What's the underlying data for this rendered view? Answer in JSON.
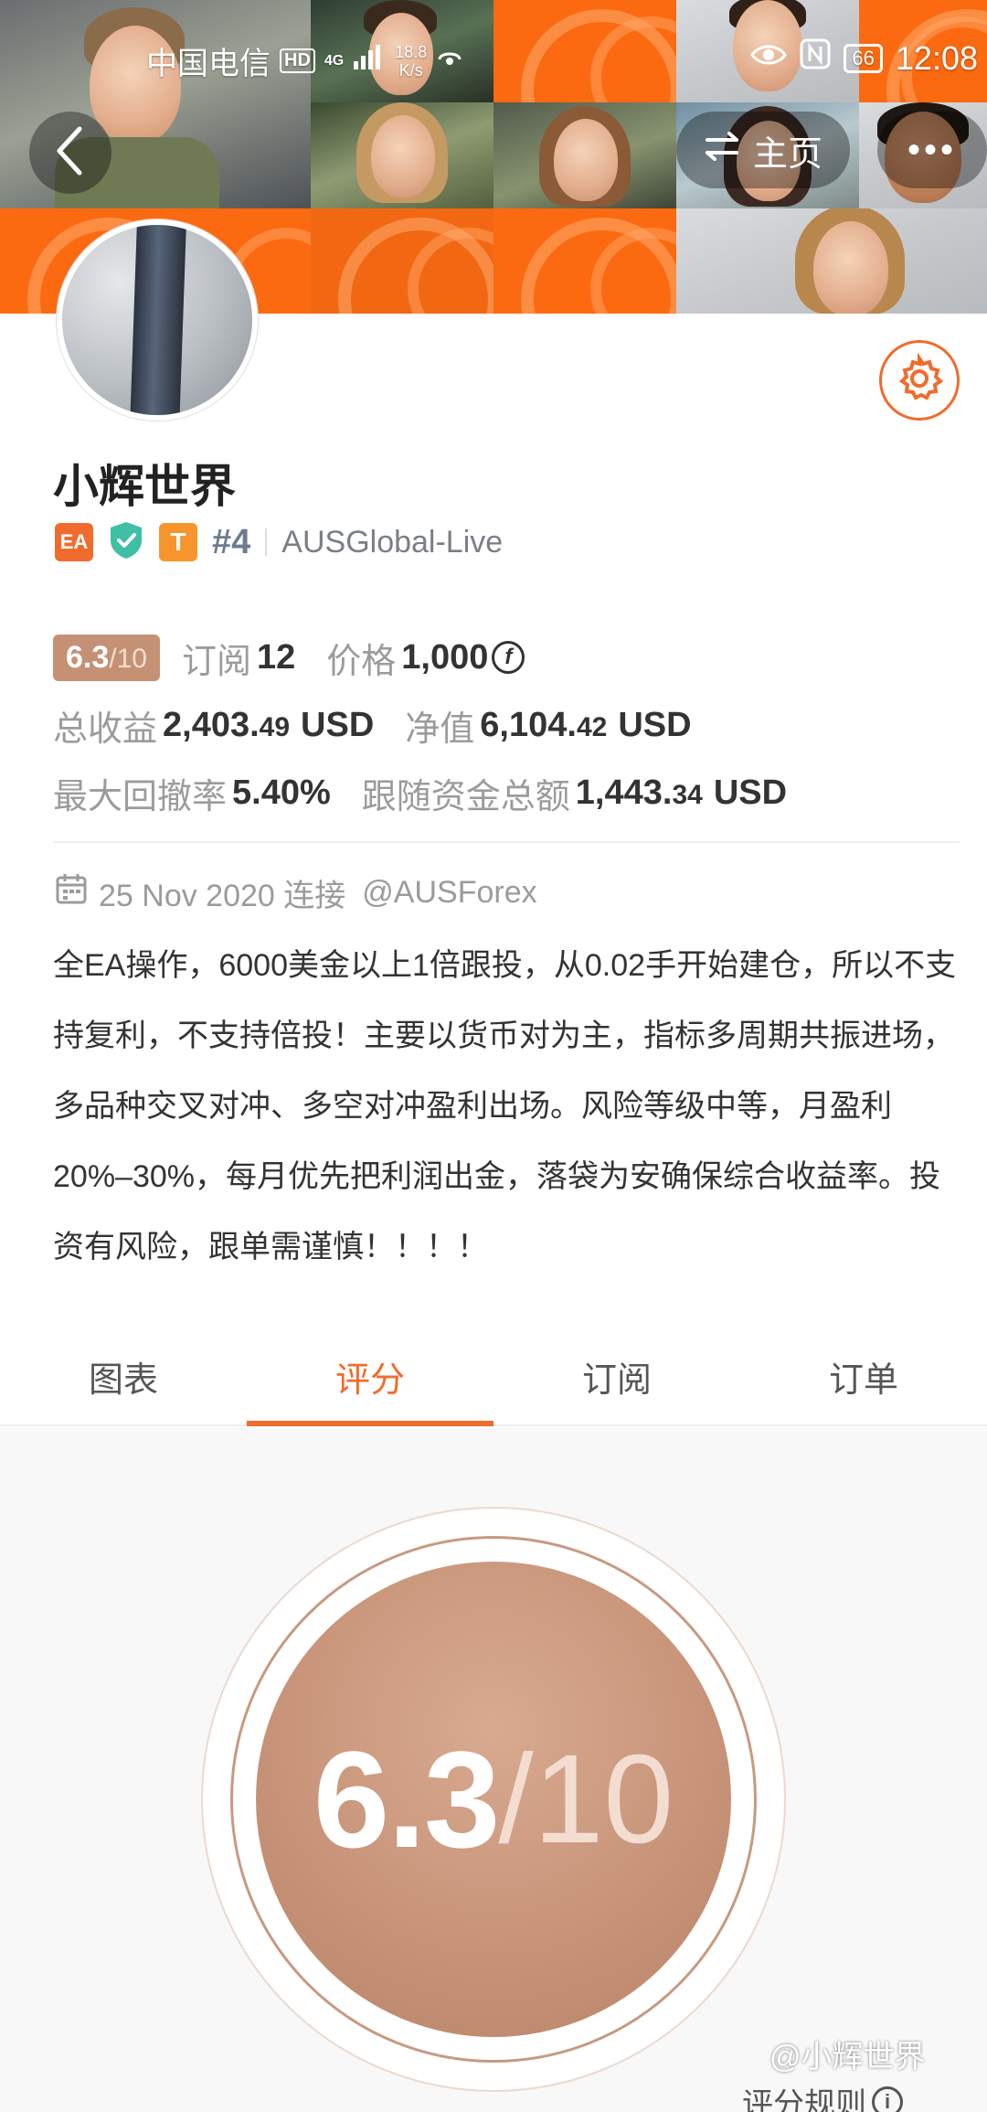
{
  "status_bar": {
    "carrier": "中国电信",
    "hd_badge": "HD",
    "network_type": "4G",
    "net_speed_value": "18.8",
    "net_speed_unit": "K/s",
    "battery": "66",
    "time": "12:08"
  },
  "header": {
    "home_label": "主页",
    "more_label": "•••"
  },
  "profile": {
    "name": "小辉世界",
    "badge_ea": "EA",
    "badge_t": "T",
    "rank": "#4",
    "server": "AUSGlobal-Live"
  },
  "stats": {
    "score_main": "6.3",
    "score_den": "/10",
    "subscribe_label": "订阅",
    "subscribe_value": "12",
    "price_label": "价格",
    "price_value": "1,000",
    "total_profit_label": "总收益",
    "total_profit_int": "2,403.",
    "total_profit_dec": "49",
    "total_profit_unit": "USD",
    "net_value_label": "净值",
    "net_value_int": "6,104.",
    "net_value_dec": "42",
    "net_value_unit": "USD",
    "drawdown_label": "最大回撤率",
    "drawdown_value": "5.40%",
    "follow_funds_label": "跟随资金总额",
    "follow_funds_int": "1,443.",
    "follow_funds_dec": "34",
    "follow_funds_unit": "USD"
  },
  "connection": {
    "date_text": "25 Nov 2020 连接",
    "handle": "@AUSForex"
  },
  "description": "全EA操作，6000美金以上1倍跟投，从0.02手开始建仓，所以不支持复利，不支持倍投！主要以货币对为主，指标多周期共振进场，多品种交叉对冲、多空对冲盈利出场。风险等级中等，月盈利20%–30%，每月优先把利润出金，落袋为安确保综合收益率。投资有风险，跟单需谨慎！！！！",
  "tabs": [
    {
      "label": "图表",
      "active": false
    },
    {
      "label": "评分",
      "active": true
    },
    {
      "label": "订阅",
      "active": false
    },
    {
      "label": "订单",
      "active": false
    }
  ],
  "score_panel": {
    "score": "6.3",
    "den": "/10",
    "rules_label": "评分规则"
  },
  "watermark": "@小辉世界",
  "colors": {
    "accent": "#f06b2c",
    "score_chip": "#c59175",
    "banner_orange": "#fb6a10"
  }
}
